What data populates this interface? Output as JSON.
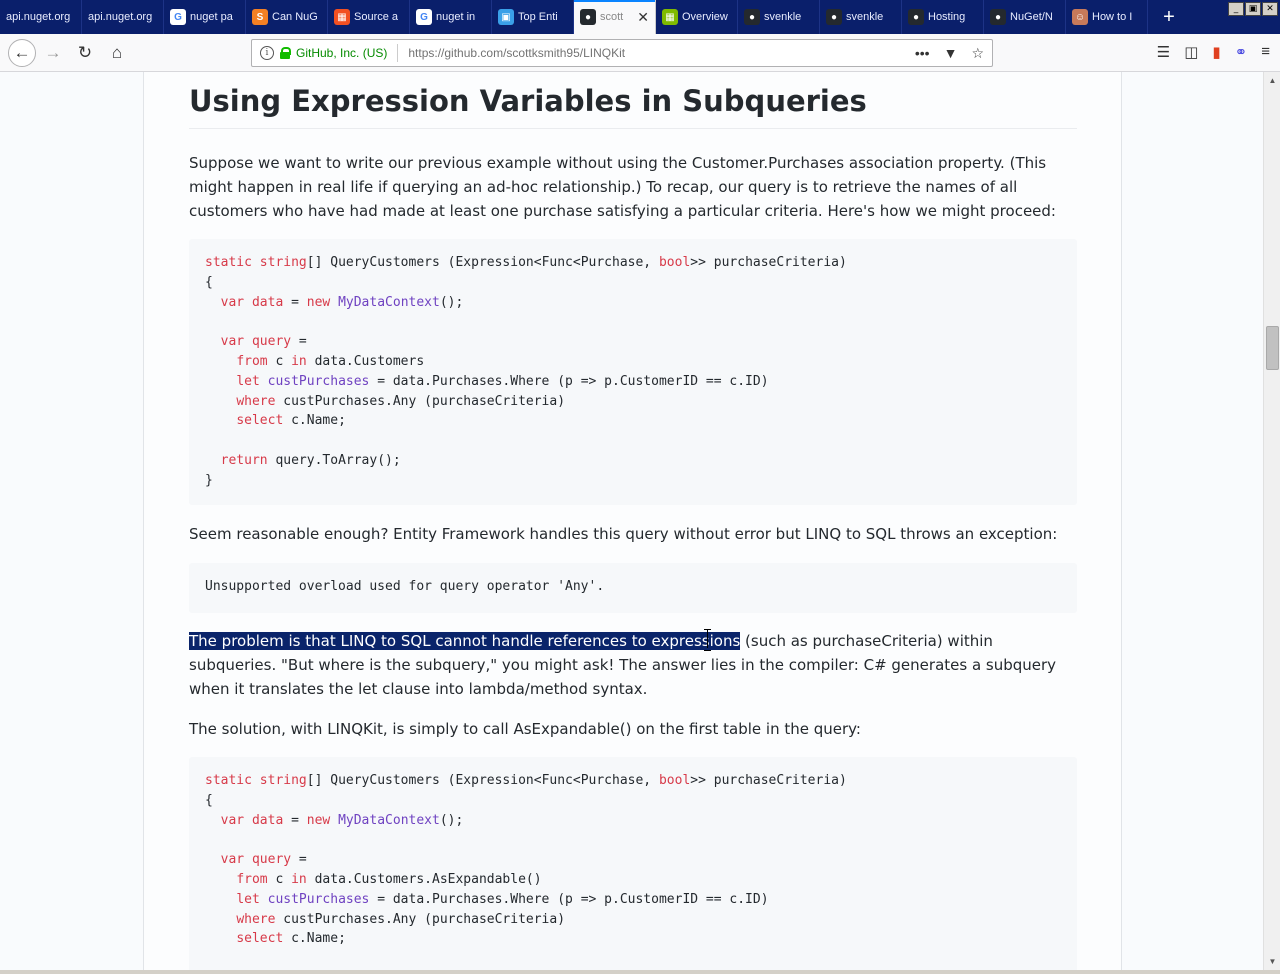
{
  "tabs": [
    {
      "label": "api.nuget.org",
      "icon": "page-icon",
      "color": "#0a1f6b"
    },
    {
      "label": "api.nuget.org",
      "icon": "page-icon",
      "color": "#0a1f6b"
    },
    {
      "label": "nuget pa",
      "icon": "google-icon",
      "color": "#ffffff"
    },
    {
      "label": "Can NuG",
      "icon": "stackoverflow-icon",
      "color": "#f48024"
    },
    {
      "label": "Source a",
      "icon": "microsoft-icon",
      "color": "#f25022"
    },
    {
      "label": "nuget in",
      "icon": "google-icon",
      "color": "#ffffff"
    },
    {
      "label": "Top Enti",
      "icon": "site-icon",
      "color": "#3aa0e8"
    },
    {
      "label": "scott",
      "icon": "github-icon",
      "color": "#24292e",
      "active": true
    },
    {
      "label": "Overview",
      "icon": "microsoft-icon",
      "color": "#7fba00"
    },
    {
      "label": "svenkle",
      "icon": "github-icon",
      "color": "#24292e"
    },
    {
      "label": "svenkle",
      "icon": "github-icon",
      "color": "#24292e"
    },
    {
      "label": "Hosting",
      "icon": "github-icon",
      "color": "#24292e"
    },
    {
      "label": "NuGet/N",
      "icon": "github-icon",
      "color": "#24292e"
    },
    {
      "label": "How to I",
      "icon": "avatar-icon",
      "color": "#c87a5a"
    }
  ],
  "urlbar": {
    "identity": "GitHub, Inc. (US)",
    "url": "https://github.com/scottksmith95/LINQKit"
  },
  "article": {
    "heading": "Using Expression Variables in Subqueries",
    "para1": "Suppose we want to write our previous example without using the Customer.Purchases association property. (This might happen in real life if querying an ad-hoc relationship.) To recap, our query is to retrieve the names of all customers who have had made at least one purchase satisfying a particular criteria. Here's how we might proceed:",
    "code1": [
      [
        [
          "kw",
          "static"
        ],
        [
          "pl",
          " "
        ],
        [
          "kw",
          "string"
        ],
        [
          "pl",
          "[] QueryCustomers (Expression<Func<Purchase, "
        ],
        [
          "kw",
          "bool"
        ],
        [
          "pl",
          ">> purchaseCriteria)"
        ]
      ],
      [
        [
          "pl",
          "{"
        ]
      ],
      [
        [
          "pl",
          "  "
        ],
        [
          "kw",
          "var"
        ],
        [
          "pl",
          " "
        ],
        [
          "kw",
          "data"
        ],
        [
          "pl",
          " = "
        ],
        [
          "kw",
          "new"
        ],
        [
          "pl",
          " "
        ],
        [
          "ty",
          "MyDataContext"
        ],
        [
          "pl",
          "();"
        ]
      ],
      [
        [
          "pl",
          ""
        ]
      ],
      [
        [
          "pl",
          "  "
        ],
        [
          "kw",
          "var"
        ],
        [
          "pl",
          " "
        ],
        [
          "kw",
          "query"
        ],
        [
          "pl",
          " ="
        ]
      ],
      [
        [
          "pl",
          "    "
        ],
        [
          "kw",
          "from"
        ],
        [
          "pl",
          " c "
        ],
        [
          "kw",
          "in"
        ],
        [
          "pl",
          " data.Customers"
        ]
      ],
      [
        [
          "pl",
          "    "
        ],
        [
          "kw",
          "let"
        ],
        [
          "pl",
          " "
        ],
        [
          "ty",
          "custPurchases"
        ],
        [
          "pl",
          " = data.Purchases.Where (p => p.CustomerID == c.ID)"
        ]
      ],
      [
        [
          "pl",
          "    "
        ],
        [
          "kw",
          "where"
        ],
        [
          "pl",
          " custPurchases.Any (purchaseCriteria)"
        ]
      ],
      [
        [
          "pl",
          "    "
        ],
        [
          "kw",
          "select"
        ],
        [
          "pl",
          " c.Name;"
        ]
      ],
      [
        [
          "pl",
          ""
        ]
      ],
      [
        [
          "pl",
          "  "
        ],
        [
          "kw",
          "return"
        ],
        [
          "pl",
          " query.ToArray();"
        ]
      ],
      [
        [
          "pl",
          "}"
        ]
      ]
    ],
    "para2": "Seem reasonable enough? Entity Framework handles this query without error but LINQ to SQL throws an exception:",
    "code2": [
      [
        [
          "pl",
          "Unsupported overload used for query operator 'Any'."
        ]
      ]
    ],
    "para3_selected": "The problem is that LINQ to SQL cannot handle references to expressions",
    "para3_rest": " (such as purchaseCriteria) within subqueries. \"But where is the subquery,\" you might ask! The answer lies in the compiler: C# generates a subquery when it translates the let clause into lambda/method syntax.",
    "para4": "The solution, with LINQKit, is simply to call AsExpandable() on the first table in the query:",
    "code3": [
      [
        [
          "kw",
          "static"
        ],
        [
          "pl",
          " "
        ],
        [
          "kw",
          "string"
        ],
        [
          "pl",
          "[] QueryCustomers (Expression<Func<Purchase, "
        ],
        [
          "kw",
          "bool"
        ],
        [
          "pl",
          ">> purchaseCriteria)"
        ]
      ],
      [
        [
          "pl",
          "{"
        ]
      ],
      [
        [
          "pl",
          "  "
        ],
        [
          "kw",
          "var"
        ],
        [
          "pl",
          " "
        ],
        [
          "kw",
          "data"
        ],
        [
          "pl",
          " = "
        ],
        [
          "kw",
          "new"
        ],
        [
          "pl",
          " "
        ],
        [
          "ty",
          "MyDataContext"
        ],
        [
          "pl",
          "();"
        ]
      ],
      [
        [
          "pl",
          ""
        ]
      ],
      [
        [
          "pl",
          "  "
        ],
        [
          "kw",
          "var"
        ],
        [
          "pl",
          " "
        ],
        [
          "kw",
          "query"
        ],
        [
          "pl",
          " ="
        ]
      ],
      [
        [
          "pl",
          "    "
        ],
        [
          "kw",
          "from"
        ],
        [
          "pl",
          " c "
        ],
        [
          "kw",
          "in"
        ],
        [
          "pl",
          " data.Customers.AsExpandable()"
        ]
      ],
      [
        [
          "pl",
          "    "
        ],
        [
          "kw",
          "let"
        ],
        [
          "pl",
          " "
        ],
        [
          "ty",
          "custPurchases"
        ],
        [
          "pl",
          " = data.Purchases.Where (p => p.CustomerID == c.ID)"
        ]
      ],
      [
        [
          "pl",
          "    "
        ],
        [
          "kw",
          "where"
        ],
        [
          "pl",
          " custPurchases.Any (purchaseCriteria)"
        ]
      ],
      [
        [
          "pl",
          "    "
        ],
        [
          "kw",
          "select"
        ],
        [
          "pl",
          " c.Name;"
        ]
      ]
    ]
  },
  "colors": {
    "keyword": "#d73a49",
    "type": "#6f42c1",
    "selection": "#0a246a",
    "tabstrip": "#0a1f6b"
  }
}
